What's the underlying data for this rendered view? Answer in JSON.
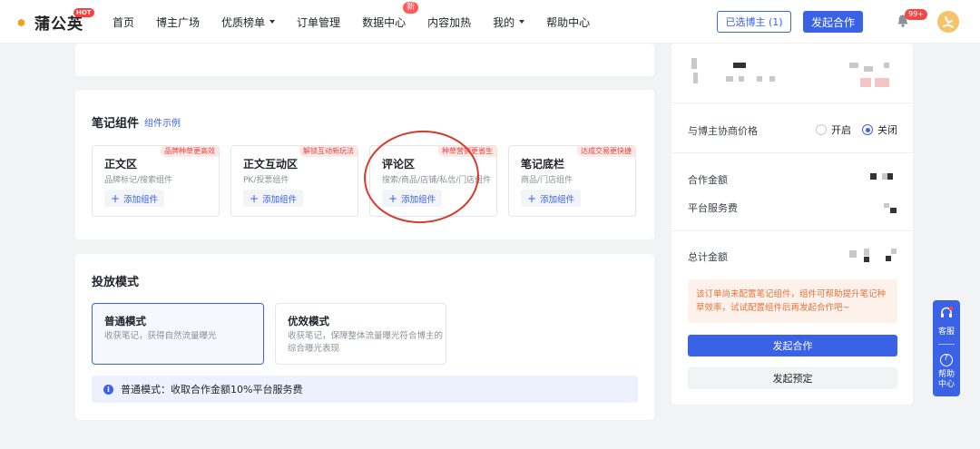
{
  "brand": {
    "name": "蒲公英",
    "badge": "HOT"
  },
  "nav": {
    "items": [
      "首页",
      "博主广场",
      "优质榜单",
      "订单管理",
      "数据中心",
      "内容加热",
      "我的",
      "帮助中心"
    ],
    "data_center_badge": "新"
  },
  "header_actions": {
    "selected_label": "已选博主 (1)",
    "launch_label": "发起合作",
    "notification_count": "99+"
  },
  "components_section": {
    "title": "笔记组件",
    "link": "组件示例",
    "items": [
      {
        "title": "正文区",
        "tag": "品牌种草更高效",
        "desc": "品牌标记/搜索组件",
        "add_label": "添加组件"
      },
      {
        "title": "正文互动区",
        "tag": "解锁互动新玩法",
        "desc": "PK/投票组件",
        "add_label": "添加组件"
      },
      {
        "title": "评论区",
        "tag": "种草营销更省生",
        "desc": "搜索/商品/店铺/私信/门店组件",
        "add_label": "添加组件"
      },
      {
        "title": "笔记底栏",
        "tag": "达成交易更快捷",
        "desc": "商品/门店组件",
        "add_label": "添加组件"
      }
    ]
  },
  "mode_section": {
    "title": "投放模式",
    "modes": [
      {
        "title": "普通模式",
        "desc_line1": "收获笔记，获得自然流量曝光",
        "desc_line2": "",
        "selected": true
      },
      {
        "title": "优效模式",
        "desc_line1": "收获笔记，保障整体流量曝光符合博主的",
        "desc_line2": "综合曝光表现",
        "selected": false
      }
    ],
    "notice": "普通模式：收取合作金额10%平台服务费"
  },
  "summary_panel": {
    "negotiate_label": "与博主协商价格",
    "option_on": "开启",
    "option_off": "关闭",
    "selected_option": "关闭",
    "amount_label": "合作金额",
    "service_fee_label": "平台服务费",
    "total_label": "总计金额",
    "tip": "该订单尚未配置笔记组件，组件可帮助提升笔记种草效率，试试配置组件后再发起合作吧~",
    "launch_label": "发起合作",
    "reserve_label": "发起预定"
  },
  "float_help": {
    "service_label": "客服",
    "help_label_line1": "帮助",
    "help_label_line2": "中心"
  },
  "colors": {
    "primary": "#3a62e6",
    "tag_red": "#e8453c",
    "tip_orange": "#e4743a",
    "annotation_circle": "#d63b2b"
  }
}
